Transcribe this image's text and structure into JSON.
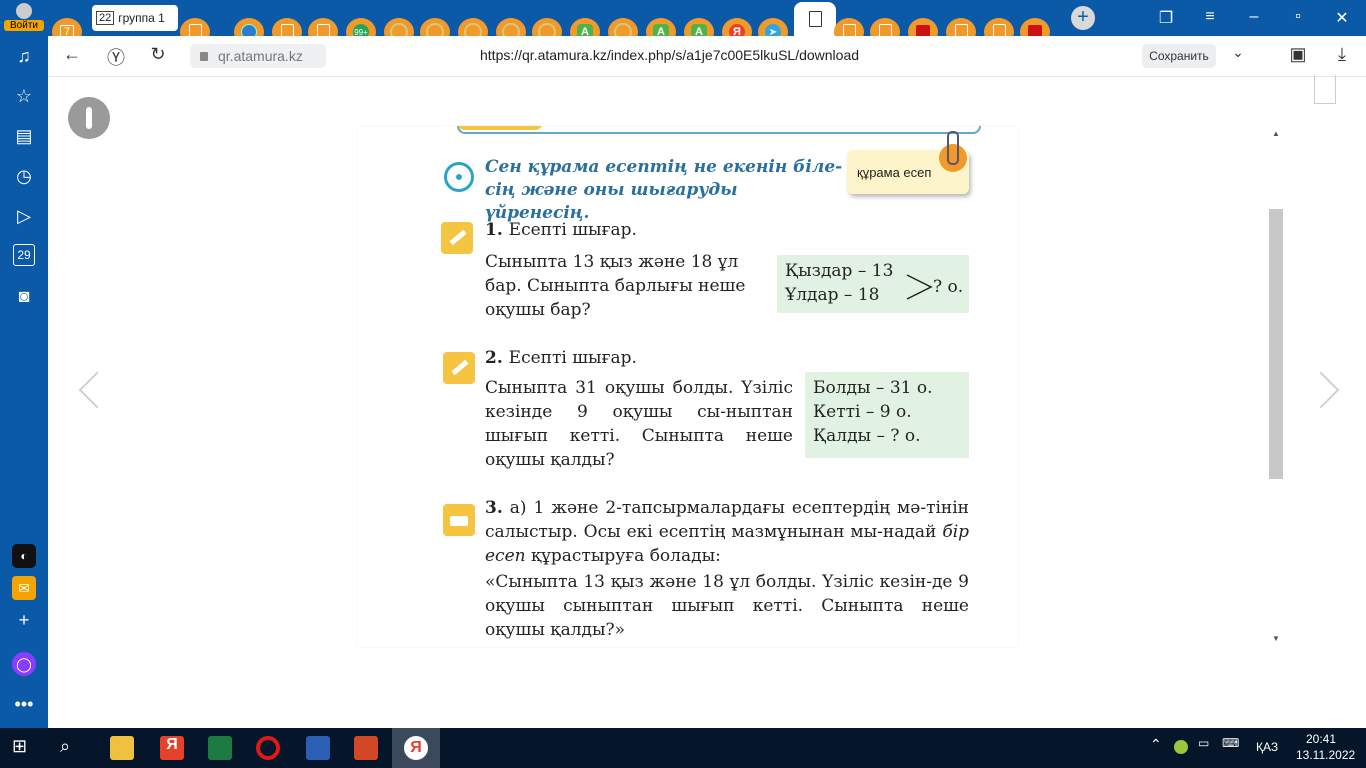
{
  "browser": {
    "login_label": "Войти",
    "tab_first_number": "7",
    "group_tab": {
      "number": "22",
      "label": "группа 1"
    },
    "pinned_tabs": [
      {
        "icon": "folder-add-icon"
      },
      {
        "icon": "globe-icon"
      },
      {
        "icon": "document-icon"
      },
      {
        "icon": "document-icon"
      },
      {
        "icon": "badge-99-icon"
      },
      {
        "icon": "bulb-icon"
      },
      {
        "icon": "bulb-icon"
      },
      {
        "icon": "bulb-icon"
      },
      {
        "icon": "bulb-icon"
      },
      {
        "icon": "a-icon"
      },
      {
        "icon": "bulb-icon"
      },
      {
        "icon": "a-icon"
      },
      {
        "icon": "a-icon"
      },
      {
        "icon": "yandex-icon"
      },
      {
        "icon": "telegram-icon"
      },
      {
        "icon": "document-icon",
        "active": true
      },
      {
        "icon": "document-icon"
      },
      {
        "icon": "document-icon"
      },
      {
        "icon": "red-app-icon"
      },
      {
        "icon": "document-icon"
      },
      {
        "icon": "document-icon"
      },
      {
        "icon": "red-app-icon"
      }
    ],
    "badge_99": "99+",
    "a_letter": "A",
    "ya_letter": "Я",
    "domain": "qr.atamura.kz",
    "url": "https://qr.atamura.kz/index.php/s/a1je7c00E5lkuSL/download",
    "save_label": "Сохранить",
    "sidebar_calendar": "29"
  },
  "page": {
    "sticky_note": "құрама есеп",
    "goal_text": "Сен құрама есептің не екенін біле-сің және оны шығаруды үйренесің.",
    "task1": {
      "title_num": "1.",
      "title": "Есепті шығар.",
      "text": "Сыныпта 13 қыз және 18 ұл бар. Сыныпта барлығы неше оқушы бар?",
      "box_line1": "Қыздар – 13",
      "box_line2": "Ұлдар – 18",
      "box_answer": "? о."
    },
    "task2": {
      "title_num": "2.",
      "title": "Есепті шығар.",
      "text": "Сыныпта 31 оқушы болды. Үзіліс кезінде 9 оқушы сы-ныптан шығып кетті. Сыныпта неше оқушы қалды?",
      "box_line1": "Болды – 31 о.",
      "box_line2": "Кетті – 9 о.",
      "box_line3": "Қалды – ? о."
    },
    "task3": {
      "title_num": "3.",
      "text_part1": "а) 1 және 2-тапсырмалардағы есептердің мә-тінін салыстыр. Осы екі есептің мазмұнынан мы-надай",
      "text_italic": "бір есеп",
      "text_part2": "құрастыруға болады:",
      "quote": "«Сыныпта 13 қыз және 18 ұл болды. Үзіліс кезін-де 9 оқушы сыныптан шығып кетті. Сыныпта неше оқушы қалды?»"
    }
  },
  "taskbar": {
    "lang": "ҚАЗ",
    "time": "20:41",
    "date": "13.11.2022"
  }
}
